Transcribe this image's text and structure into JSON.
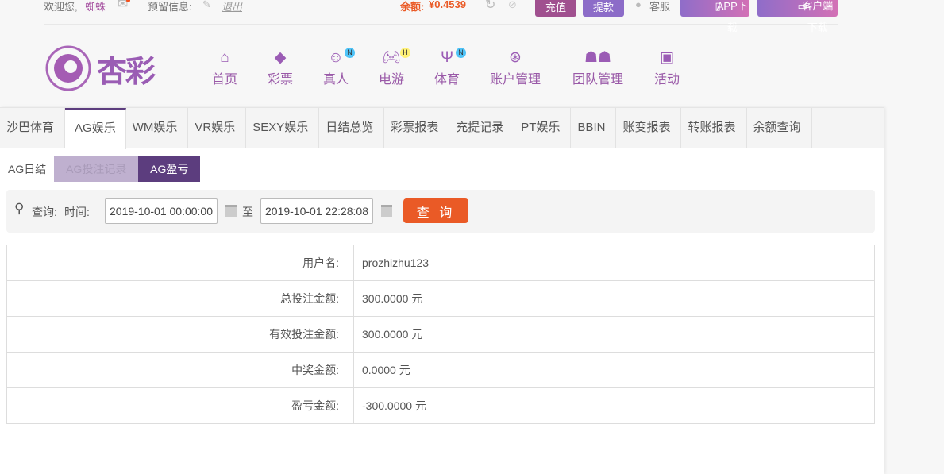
{
  "topbar": {
    "welcome": "欢迎您,",
    "username": "蜘蛛",
    "messages_label": "预留信息:",
    "logout": "退出",
    "balance_label": "余额:",
    "balance": "¥0.4539",
    "recharge": "充值",
    "withdraw": "提款",
    "service": "客服",
    "app_download": "APP下载",
    "client_download": "客户端下载"
  },
  "logo": {
    "text": "杏彩"
  },
  "nav": [
    {
      "label": "首页",
      "icon": "home-icon"
    },
    {
      "label": "彩票",
      "icon": "ticket-icon"
    },
    {
      "label": "真人",
      "icon": "live-dealer-icon",
      "badge": "N"
    },
    {
      "label": "电游",
      "icon": "gamepad-icon",
      "badge": "H"
    },
    {
      "label": "体育",
      "icon": "trophy-icon",
      "badge": "N"
    },
    {
      "label": "账户管理",
      "icon": "yen-coin-icon"
    },
    {
      "label": "团队管理",
      "icon": "team-icon"
    },
    {
      "label": "活动",
      "icon": "gift-icon"
    }
  ],
  "tabs": [
    "沙巴体育",
    "AG娱乐",
    "WM娱乐",
    "VR娱乐",
    "SEXY娱乐",
    "日结总览",
    "彩票报表",
    "充提记录",
    "PT娱乐",
    "BBIN",
    "账变报表",
    "转账报表",
    "余额查询"
  ],
  "subtabs": [
    "AG日结",
    "AG投注记录",
    "AG盈亏"
  ],
  "search": {
    "query_label": "查询:",
    "time_label": "时间:",
    "start": "2019-10-01 00:00:00",
    "to": "至",
    "end": "2019-10-01 22:28:08",
    "button": "查 询"
  },
  "rows": [
    {
      "k": "用户名:",
      "v": "prozhizhu123"
    },
    {
      "k": "总投注金额:",
      "v": "300.0000 元"
    },
    {
      "k": "有效投注金额:",
      "v": "300.0000 元"
    },
    {
      "k": "中奖金额:",
      "v": "0.0000 元"
    },
    {
      "k": "盈亏金额:",
      "v": "-300.0000 元"
    }
  ]
}
